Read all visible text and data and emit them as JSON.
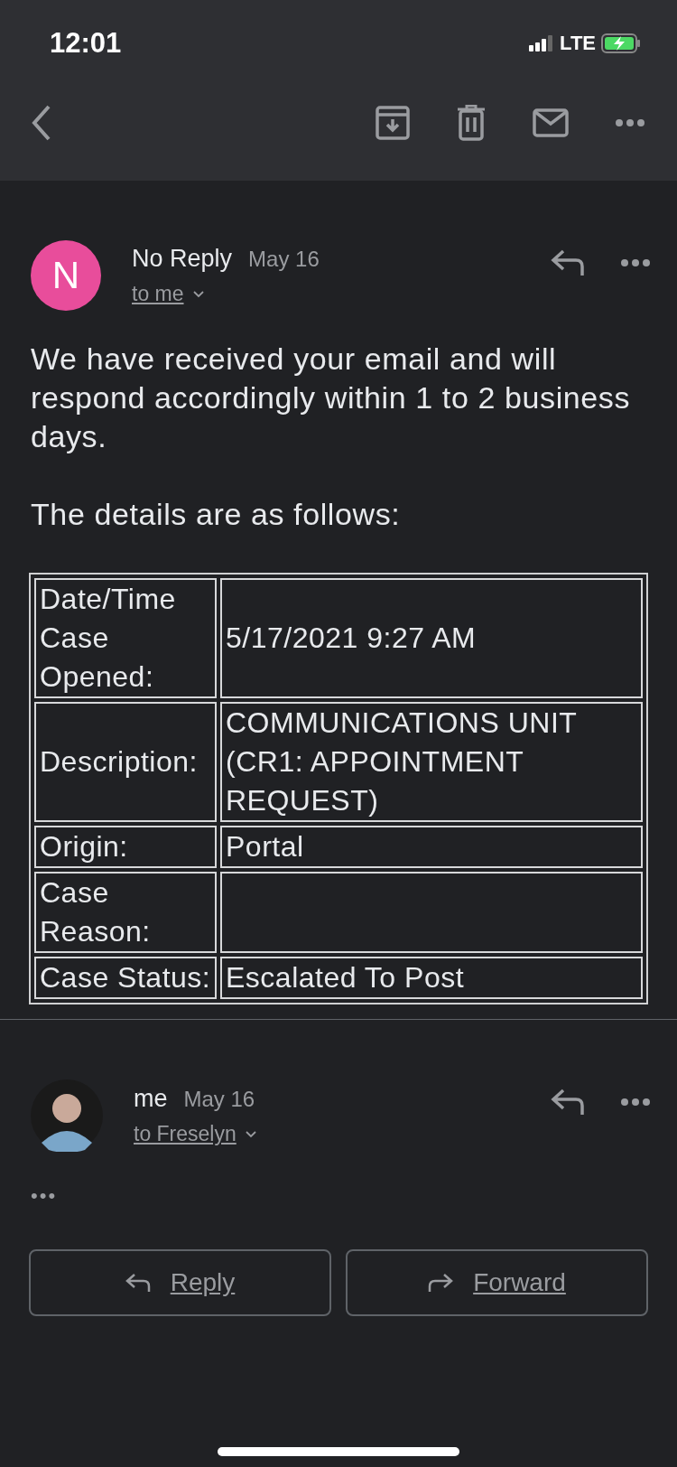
{
  "status_bar": {
    "time": "12:01",
    "network": "LTE"
  },
  "messages": [
    {
      "sender": "No Reply",
      "initial": "N",
      "date": "May 16",
      "recipient": "to me",
      "expanded": true,
      "body": [
        "We have received your email and will respond accordingly within 1 to 2 business days.",
        "The details are as follows:"
      ],
      "table": [
        {
          "label": "Date/Time Case Opened:",
          "value": "5/17/2021 9:27 AM"
        },
        {
          "label": "Description:",
          "value": "COMMUNICATIONS UNIT (CR1: APPOINTMENT REQUEST)"
        },
        {
          "label": "Origin:",
          "value": "Portal"
        },
        {
          "label": "Case Reason:"
        },
        {
          "label": "Case Status:",
          "value": "Escalated To Post"
        }
      ]
    },
    {
      "sender": "me",
      "date": "May 16",
      "recipient": "to Freselyn",
      "expanded": false,
      "more": "•••"
    }
  ],
  "actions": [
    {
      "label": "Reply",
      "kind": "reply"
    },
    {
      "label": "Forward",
      "kind": "forward"
    }
  ]
}
